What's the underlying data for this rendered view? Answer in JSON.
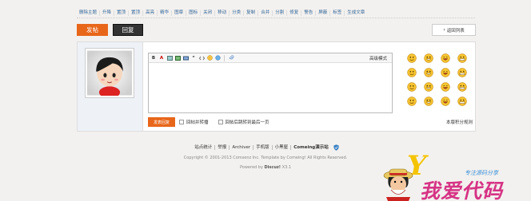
{
  "admin_bar": {
    "actions": [
      "删除主题",
      "升降",
      "置顶",
      "置顶",
      "高亮",
      "精华",
      "图章",
      "图标",
      "关闭",
      "移动",
      "分类",
      "复制",
      "合并",
      "分割",
      "修复",
      "警告",
      "屏蔽",
      "标签",
      "生成文章"
    ]
  },
  "buttons": {
    "post": "发帖",
    "reply": "回复",
    "back_to_list": "返回列表"
  },
  "editor": {
    "toolbar_icons": [
      "bold-icon",
      "font-color-icon",
      "image-icon",
      "attach-icon",
      "link-icon",
      "quote-icon",
      "code-icon",
      "smiley-icon",
      "at-icon",
      "attachment-clip-icon"
    ],
    "advanced_mode": "高级模式"
  },
  "smileys": [
    "smile",
    "grin",
    "laugh",
    "titter",
    "angry",
    "shy",
    "surprise",
    "tongue",
    "cry",
    "wink",
    "awkward",
    "grimace",
    "sweat",
    "sleep",
    "shocked",
    "question"
  ],
  "submit": {
    "button": "发表回复",
    "option_1": "回帖并转播",
    "option_2": "回帖后跳转到最后一页",
    "rules_link": "本版积分规则"
  },
  "footer": {
    "links": [
      "站点统计",
      "举报",
      "Archiver",
      "手机版",
      "小黑屋",
      "Comeing演示站"
    ],
    "copyright": "Copyright © 2001-2013 Comsenz Inc. Template by Comeing! All Rights Reserved.",
    "powered_label": "Powered by",
    "powered_product": "Discuz!",
    "powered_version": "X3.1"
  },
  "watermark": {
    "text": "我爱代码",
    "subtitle": "专注源码分享"
  },
  "colors": {
    "accent": "#e8661a",
    "link": "#336699",
    "background": "#f3f1ef",
    "avatar_bg": "#eef2f7"
  }
}
